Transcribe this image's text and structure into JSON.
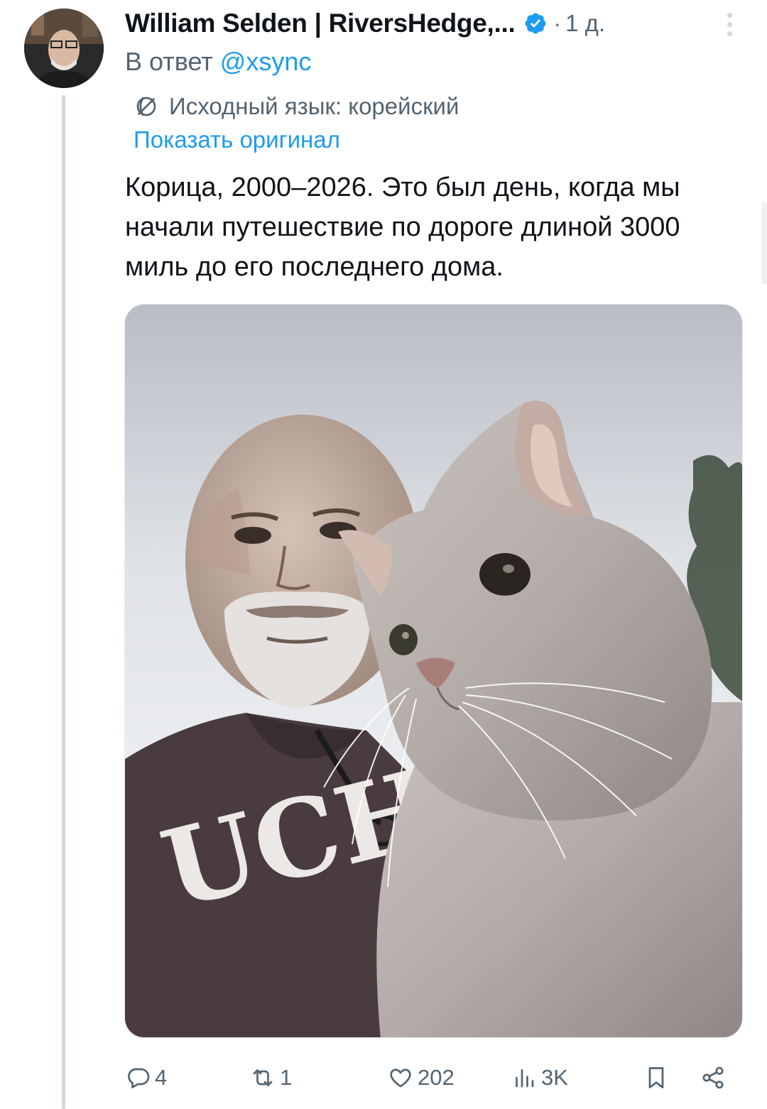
{
  "header": {
    "author_name": "William Selden | RiversHedge,...",
    "separator": "·",
    "time": "1 д."
  },
  "reply": {
    "prefix": "В ответ",
    "handle": "@xsync"
  },
  "translation": {
    "note": "Исходный язык: корейский",
    "show_original": "Показать оригинал"
  },
  "tweet": {
    "text": "Корица, 2000–2026. Это был день, когда мы начали путешествие по дороге длиной 3000 миль до его последнего дома."
  },
  "photo": {
    "shirt_text": "UCH"
  },
  "actions": {
    "replies": "4",
    "retweets": "1",
    "likes": "202",
    "views": "3K"
  },
  "icons": {
    "verified": "verified-badge-icon",
    "translate": "translate-icon",
    "reply": "reply-icon",
    "retweet": "retweet-icon",
    "like": "heart-icon",
    "views": "views-icon",
    "bookmark": "bookmark-icon",
    "share": "share-icon"
  },
  "colors": {
    "accent": "#1d9bf0",
    "secondary_text": "#536471",
    "primary_text": "#0f1419",
    "thread_line": "#cfd9de"
  }
}
